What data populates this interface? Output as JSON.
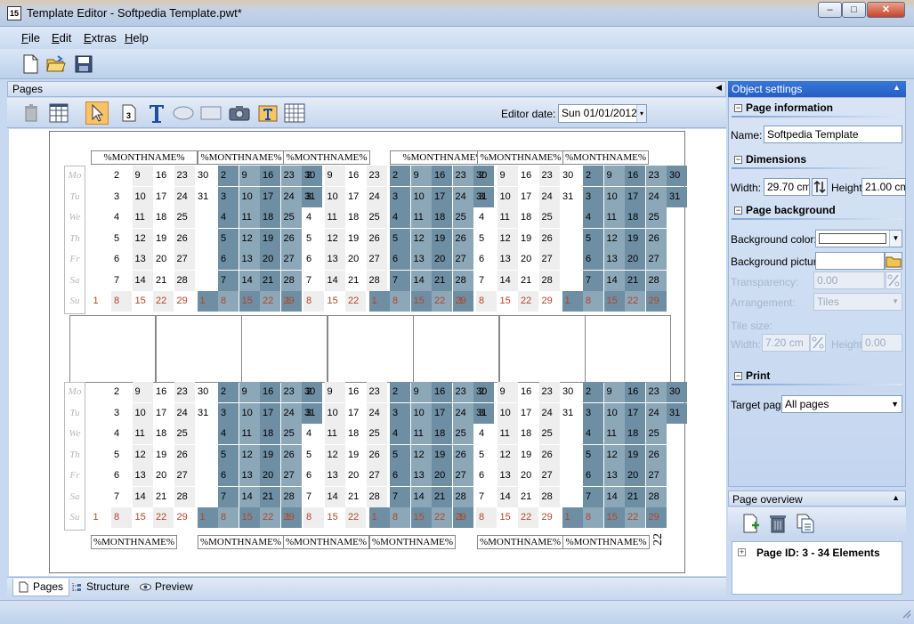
{
  "window": {
    "title": "Template Editor - Softpedia Template.pwt*",
    "icon_label": "15",
    "controls": {
      "minimize": "–",
      "maximize": "□",
      "close": "✕"
    }
  },
  "menu": [
    {
      "key": "F",
      "rest": "ile"
    },
    {
      "key": "E",
      "rest": "dit"
    },
    {
      "key": "E",
      "rest": "xtras"
    },
    {
      "key": "H",
      "rest": "elp"
    }
  ],
  "pages_panel": {
    "title": "Pages",
    "collapse_glyph": "◀",
    "editor_date_label": "Editor date:",
    "editor_date_value": "Sun 01/01/2012",
    "editor_date_arrow": "▾"
  },
  "calendar": {
    "month_placeholder": "%MONTHNAME%",
    "day_names": [
      "Mo",
      "Tu",
      "We",
      "Th",
      "Fr",
      "Sa",
      "Su"
    ],
    "row1_numbers": [
      "2",
      "9",
      "16",
      "23",
      "30"
    ],
    "row2_numbers": [
      "3",
      "10",
      "17",
      "24",
      "31"
    ],
    "row3_numbers": [
      "4",
      "11",
      "18",
      "25"
    ],
    "row4_numbers": [
      "5",
      "12",
      "19",
      "26"
    ],
    "row5_numbers": [
      "6",
      "13",
      "20",
      "27"
    ],
    "row6_numbers": [
      "7",
      "14",
      "21",
      "28"
    ],
    "row7_numbers": [
      "1",
      "8",
      "15",
      "22",
      "29"
    ],
    "side_digit": "22"
  },
  "page_tabs": [
    {
      "label": "Pages",
      "active": true
    },
    {
      "label": "Structure",
      "active": false
    },
    {
      "label": "Preview",
      "active": false
    }
  ],
  "object_settings": {
    "title": "Object settings",
    "collapse_glyph": "▲",
    "page_information": {
      "title": "Page information",
      "name_label": "Name:",
      "name_value": "Softpedia Template"
    },
    "dimensions": {
      "title": "Dimensions",
      "width_label": "Width:",
      "width_value": "29.70 cm",
      "height_label": "Height:",
      "height_value": "21.00 cm"
    },
    "page_background": {
      "title": "Page background",
      "bg_color_label": "Background color:",
      "bg_picture_label": "Background picture",
      "transparency_label": "Transparency:",
      "transparency_value": "0.00",
      "arrangement_label": "Arrangement:",
      "arrangement_value": "Tiles",
      "tile_size_label": "Tile size:",
      "tile_width_label": "Width:",
      "tile_width_value": "7.20 cm",
      "tile_height_label": "Height:",
      "tile_height_value": "0.00"
    },
    "print": {
      "title": "Print",
      "target_label": "Target page",
      "target_value": "All pages"
    }
  },
  "page_overview": {
    "title": "Page overview",
    "collapse_glyph": "▲",
    "node_expander": "+",
    "node_label": "Page ID: 3 - 34 Elements"
  },
  "colors": {
    "accent_blue": "#245fc4",
    "cell_dark": "#6e8ea3",
    "cell_medium": "#8ca7b8",
    "cell_light": "#eeeeee",
    "sunday_text": "#b0462a"
  }
}
